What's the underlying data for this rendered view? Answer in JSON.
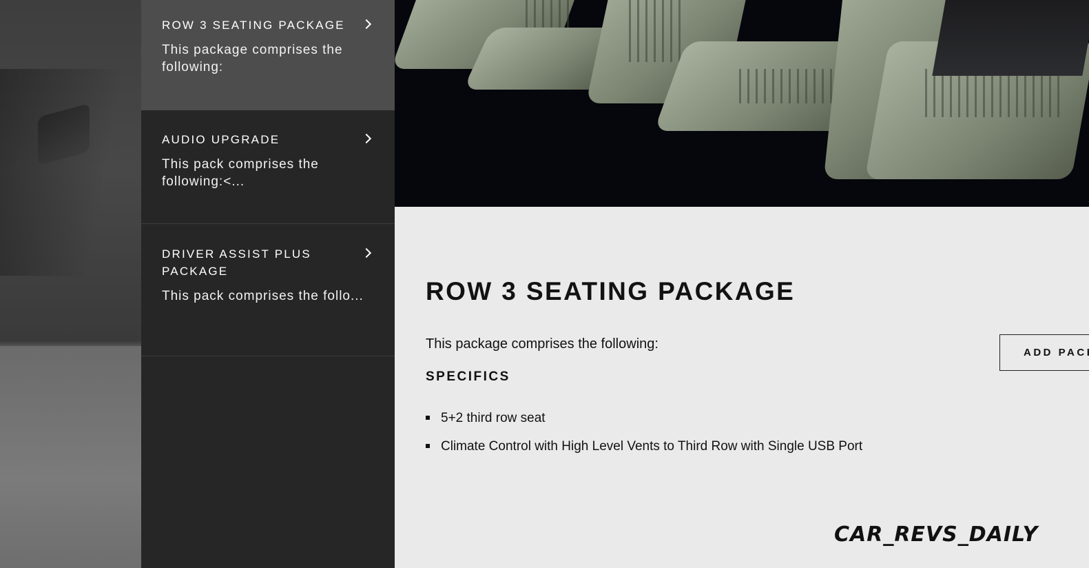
{
  "sidebar": {
    "items": [
      {
        "title": "ROW 3 SEATING PACKAGE",
        "description": "This package comprises the following:"
      },
      {
        "title": "AUDIO UPGRADE",
        "description": "This pack comprises the following:<..."
      },
      {
        "title": "DRIVER ASSIST PLUS PACKAGE",
        "description": "This pack comprises the follo..."
      }
    ]
  },
  "detail": {
    "title": "ROW 3 SEATING PACKAGE",
    "intro": "This package comprises the following:",
    "specifics_heading": "SPECIFICS",
    "specifics": [
      "5+2 third row seat",
      "Climate Control with High Level Vents to Third Row with Single USB Port"
    ],
    "add_button_label": "ADD PACKAGE"
  },
  "watermark": "CAR_REVS_DAILY",
  "icons": {
    "item_chevron": "chevron-right-icon",
    "bullet": "square-bullet-icon"
  },
  "colors": {
    "sidebar_bg": "#262626",
    "sidebar_active_bg": "#4d4d4d",
    "content_bg": "#eaeaea",
    "text_dark": "#111111"
  }
}
